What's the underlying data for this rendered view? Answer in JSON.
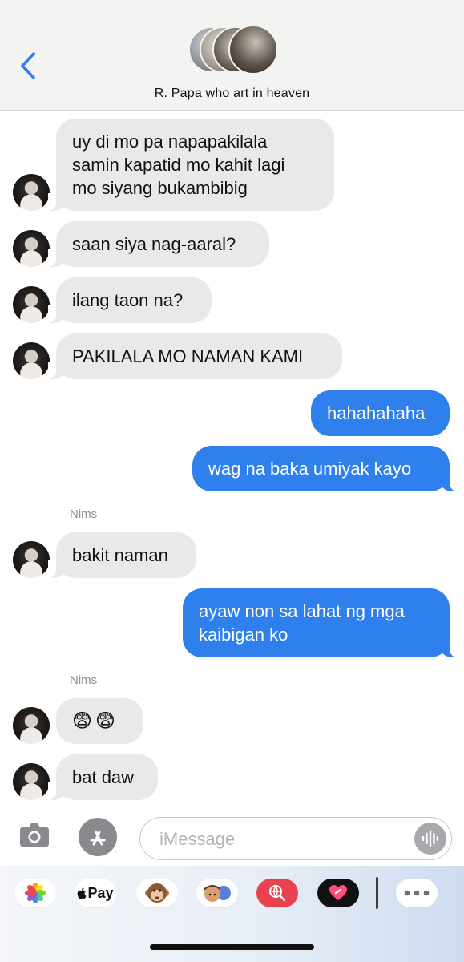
{
  "header": {
    "contact_name": "R. Papa who art in heaven",
    "back_icon": "chevron-left-icon",
    "group_avatar_count": 4
  },
  "messages": [
    {
      "direction": "incoming",
      "sender": "",
      "text": "uy di mo pa napapakilala\nsamin kapatid mo kahit lagi\nmo siyang bukambibig"
    },
    {
      "direction": "incoming",
      "sender": "",
      "text": "saan siya nag-aaral?"
    },
    {
      "direction": "incoming",
      "sender": "",
      "text": "ilang taon na?"
    },
    {
      "direction": "incoming",
      "sender": "",
      "text": "PAKILALA MO NAMAN KAMI"
    },
    {
      "direction": "outgoing",
      "text": "hahahahaha"
    },
    {
      "direction": "outgoing",
      "text": "wag na baka umiyak kayo"
    },
    {
      "direction": "incoming",
      "sender": "Nims",
      "text": "bakit naman"
    },
    {
      "direction": "outgoing",
      "text": "ayaw non sa lahat ng mga\nkaibigan ko"
    },
    {
      "direction": "incoming",
      "sender": "Nims",
      "text": "😨😨"
    },
    {
      "direction": "incoming",
      "sender": "",
      "text": "bat daw"
    }
  ],
  "composer": {
    "placeholder": "iMessage",
    "camera_icon": "camera-icon",
    "apps_icon": "app-store-icon",
    "audio_icon": "audio-waveform-icon"
  },
  "app_drawer": [
    {
      "name": "photos-app-icon"
    },
    {
      "name": "apple-pay-icon",
      "label": "Pay"
    },
    {
      "name": "memoji-monkey-icon"
    },
    {
      "name": "memoji-stickers-icon"
    },
    {
      "name": "web-search-icon"
    },
    {
      "name": "digital-touch-icon"
    },
    {
      "name": "more-apps-icon"
    }
  ],
  "colors": {
    "outgoing_bubble": "#2f80ed",
    "incoming_bubble": "#e9e9eb",
    "accent": "#2f80ed"
  }
}
